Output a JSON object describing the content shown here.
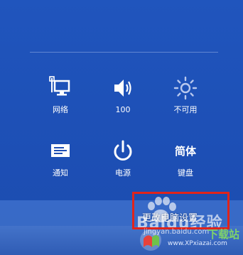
{
  "quick_settings": [
    {
      "id": "network",
      "label": "网络",
      "icon": "network-icon"
    },
    {
      "id": "volume",
      "label": "100",
      "icon": "volume-icon"
    },
    {
      "id": "brightness",
      "label": "不可用",
      "icon": "brightness-icon"
    },
    {
      "id": "notifications",
      "label": "通知",
      "icon": "notifications-icon"
    },
    {
      "id": "power",
      "label": "电源",
      "icon": "power-icon"
    },
    {
      "id": "keyboard",
      "label": "键盘",
      "icon_text": "简体",
      "icon": "keyboard-ime-icon"
    }
  ],
  "more_settings": {
    "label": "更改电脑设置"
  },
  "watermarks": {
    "baidu": "Baidu经验",
    "jingyan_url": "jingyan.baidu.com",
    "xpx_cn": "下载站",
    "xpx_url": "www.XPxiazai.com"
  },
  "colors": {
    "background": "#1f4fb4",
    "highlight_border": "#e0241b"
  }
}
